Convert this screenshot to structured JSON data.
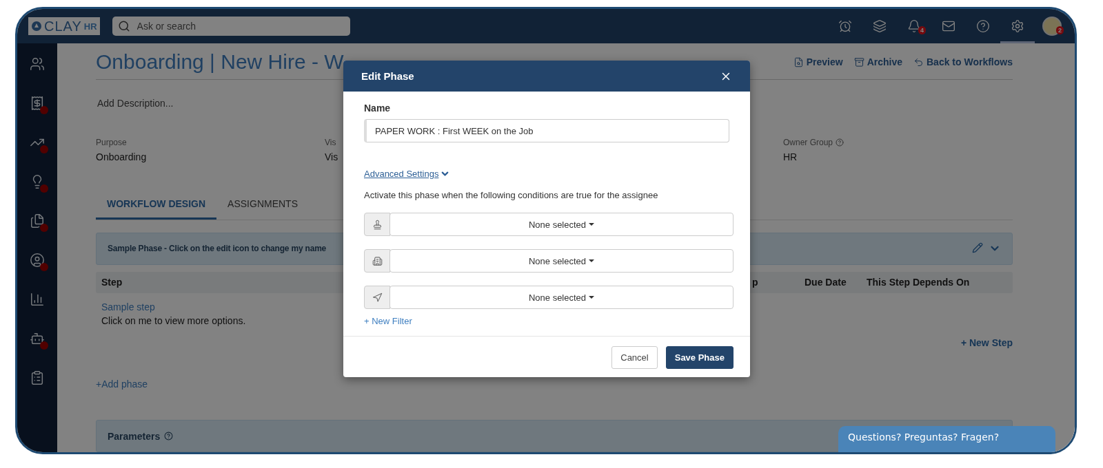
{
  "topbar": {
    "logo": {
      "main": "CLAY",
      "sub": "HR"
    },
    "search": {
      "placeholder": "Ask or search"
    },
    "icons": [
      {
        "kind": "icon",
        "selected": false
      },
      {
        "kind": "icon",
        "selected": false
      },
      {
        "kind": "icon",
        "selected": false,
        "badge": "4"
      },
      {
        "kind": "icon",
        "selected": false
      },
      {
        "kind": "icon",
        "selected": false
      },
      {
        "kind": "icon",
        "selected": true
      },
      {
        "kind": "avatar",
        "selected": false,
        "badge": "2"
      }
    ]
  },
  "sidebar": {
    "items": [
      {
        "dot": false
      },
      {
        "dot": true
      },
      {
        "dot": true
      },
      {
        "dot": true
      },
      {
        "dot": true
      },
      {
        "dot": true
      },
      {
        "dot": false
      },
      {
        "dot": true
      },
      {
        "dot": false
      }
    ]
  },
  "page": {
    "title": "Onboarding | New Hire - W",
    "actions": [
      {
        "label": "Preview"
      },
      {
        "label": "Archive"
      },
      {
        "label": "Back to Workflows"
      }
    ],
    "description_placeholder": "Add Description...",
    "fields": [
      {
        "label": "Purpose",
        "value": "Onboarding",
        "help": false
      },
      {
        "label": "Vis",
        "value": "Vis",
        "help": false
      },
      {
        "label": "Owner Group",
        "value": "HR",
        "help": true
      }
    ],
    "tabs": [
      {
        "label": "WORKFLOW DESIGN",
        "selected": true
      },
      {
        "label": "ASSIGNMENTS",
        "selected": false
      }
    ],
    "phase": {
      "title": "Sample Phase - Click on the edit icon to change my name"
    },
    "table": {
      "columns": [
        "Step",
        "p",
        "Due Date",
        "This Step Depends On"
      ],
      "rows": [
        {
          "step": "Sample step",
          "note": "Click on me to view more options."
        }
      ]
    },
    "new_step": "+ New Step",
    "add_phase": "+Add phase",
    "parameters": {
      "title": "Parameters"
    }
  },
  "modal": {
    "title": "Edit Phase",
    "name_label": "Name",
    "name_value": "PAPER WORK : First WEEK on the Job",
    "advanced": "Advanced Settings",
    "conditions_text": "Activate this phase when the following conditions are true for the assignee",
    "filters": [
      {
        "value": "None selected"
      },
      {
        "value": "None selected"
      },
      {
        "value": "None selected"
      }
    ],
    "new_filter": "+ New Filter",
    "buttons": [
      {
        "kind": "secondary",
        "label": "Cancel"
      },
      {
        "kind": "primary",
        "label": "Save Phase"
      }
    ]
  },
  "chat": {
    "label": "Questions? Preguntas? Fragen?"
  }
}
